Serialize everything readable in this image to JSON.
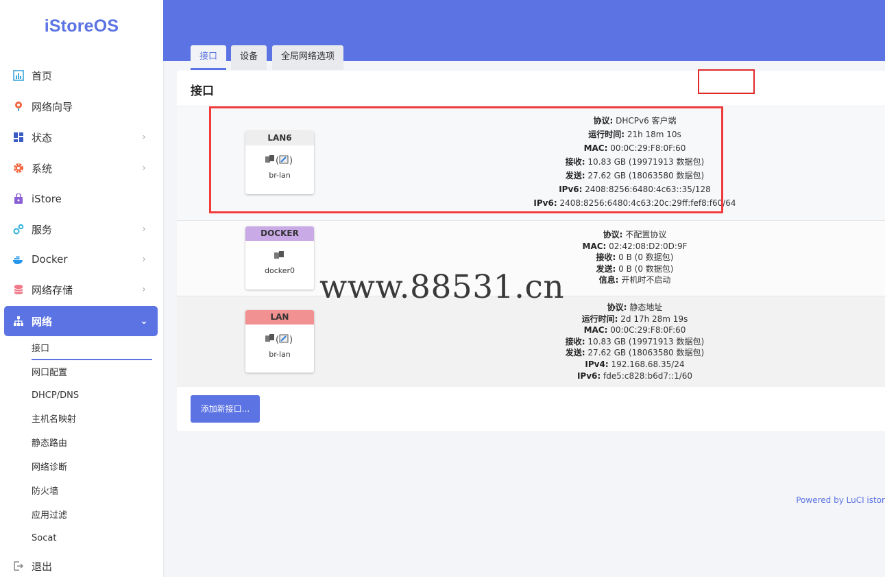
{
  "brand": "iStoreOS",
  "sidebar": {
    "items": [
      {
        "label": "首页",
        "icon": "chart-icon",
        "chevron": false
      },
      {
        "label": "网络向导",
        "icon": "globe-pin-icon",
        "chevron": false
      },
      {
        "label": "状态",
        "icon": "dashboard-icon",
        "chevron": true
      },
      {
        "label": "系统",
        "icon": "gear-icon",
        "chevron": true
      },
      {
        "label": "iStore",
        "icon": "bag-icon",
        "chevron": false
      },
      {
        "label": "服务",
        "icon": "cogs-icon",
        "chevron": true
      },
      {
        "label": "Docker",
        "icon": "docker-icon",
        "chevron": true
      },
      {
        "label": "网络存储",
        "icon": "database-icon",
        "chevron": true
      },
      {
        "label": "网络",
        "icon": "sitemap-icon",
        "chevron": true,
        "active": true
      }
    ],
    "subitems": [
      "接口",
      "网口配置",
      "DHCP/DNS",
      "主机名映射",
      "静态路由",
      "网络诊断",
      "防火墙",
      "应用过滤",
      "Socat"
    ],
    "logout": {
      "label": "退出",
      "icon": "logout-icon"
    }
  },
  "tabs": [
    {
      "label": "接口",
      "active": true
    },
    {
      "label": "设备",
      "active": false
    },
    {
      "label": "全局网络选项",
      "active": false
    }
  ],
  "main": {
    "title": "接口",
    "interfaces": [
      {
        "name": "LAN6",
        "header_color": "#eeeeee",
        "icons": "bridge-ethernet-wifi",
        "device": "br-lan",
        "info": [
          {
            "k": "协议:",
            "v": "DHCPv6 客户端"
          },
          {
            "k": "运行时间:",
            "v": "21h 18m 10s"
          },
          {
            "k": "MAC:",
            "v": "00:0C:29:F8:0F:60"
          },
          {
            "k": "接收:",
            "v": "10.83 GB (19971913 数据包)"
          },
          {
            "k": "发送:",
            "v": "27.62 GB (18063580 数据包)"
          },
          {
            "k": "IPv6:",
            "v": "2408:8256:6480:4c63::35/128"
          },
          {
            "k": "IPv6:",
            "v": "2408:8256:6480:4c63:20c:29ff:fef8:f60/64"
          }
        ]
      },
      {
        "name": "DOCKER",
        "header_color": "#c9a9e6",
        "icons": "ethernet",
        "device": "docker0",
        "info": [
          {
            "k": "协议:",
            "v": "不配置协议"
          },
          {
            "k": "MAC:",
            "v": "02:42:08:D2:0D:9F"
          },
          {
            "k": "接收:",
            "v": "0 B (0 数据包)"
          },
          {
            "k": "发送:",
            "v": "0 B (0 数据包)"
          },
          {
            "k": "信息:",
            "v": "开机时不启动"
          }
        ]
      },
      {
        "name": "LAN",
        "header_color": "#f29191",
        "icons": "bridge-ethernet-wifi",
        "device": "br-lan",
        "info": [
          {
            "k": "协议:",
            "v": "静态地址"
          },
          {
            "k": "运行时间:",
            "v": "2d 17h 28m 19s"
          },
          {
            "k": "MAC:",
            "v": "00:0C:29:F8:0F:60"
          },
          {
            "k": "接收:",
            "v": "10.83 GB (19971913 数据包)"
          },
          {
            "k": "发送:",
            "v": "27.62 GB (18063580 数据包)"
          },
          {
            "k": "IPv4:",
            "v": "192.168.68.35/24"
          },
          {
            "k": "IPv6:",
            "v": "fde5:c828:b6d7::1/60"
          }
        ]
      }
    ],
    "add_button": "添加新接口..."
  },
  "watermark": "www.88531.cn",
  "footer": "Powered by LuCI istor",
  "colors": {
    "accent": "#5b73e3",
    "highlight": "#f03c3c"
  }
}
